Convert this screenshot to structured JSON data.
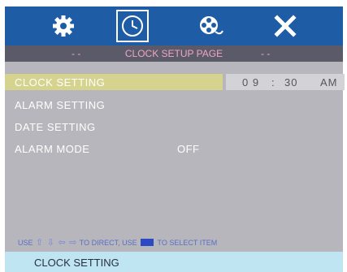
{
  "tabs": [
    {
      "icon": "gear-icon",
      "selected": false
    },
    {
      "icon": "clock-icon",
      "selected": true
    },
    {
      "icon": "film-reel-icon",
      "selected": false
    },
    {
      "icon": "close-icon",
      "selected": false
    }
  ],
  "title_bar": {
    "left_dashes": "- -",
    "title": "CLOCK SETUP PAGE",
    "right_dashes": "- -"
  },
  "menu": {
    "items": [
      {
        "label": "CLOCK  SETTING"
      },
      {
        "label": "ALARM  SETTING"
      },
      {
        "label": "DATE    SETTING"
      },
      {
        "label": "ALARM  MODE",
        "value": "OFF"
      }
    ]
  },
  "clock": {
    "hours": "0 9",
    "separator": ":",
    "minutes": "30",
    "ampm": "AM"
  },
  "hint": {
    "use_label": "USE",
    "to_direct": "TO DIRECT, USE",
    "to_select": "TO SELECT  ITEM"
  },
  "status": {
    "text": "CLOCK SETTING"
  },
  "colors": {
    "top_bar": "#1e5ca6",
    "title_bar": "#5a5a69",
    "title_text": "#f0a6c4",
    "panel": "#b6b6bc",
    "highlight": "#d6d38e",
    "status_bar": "#bfe4f2",
    "hint_text": "#5b6fc6"
  }
}
